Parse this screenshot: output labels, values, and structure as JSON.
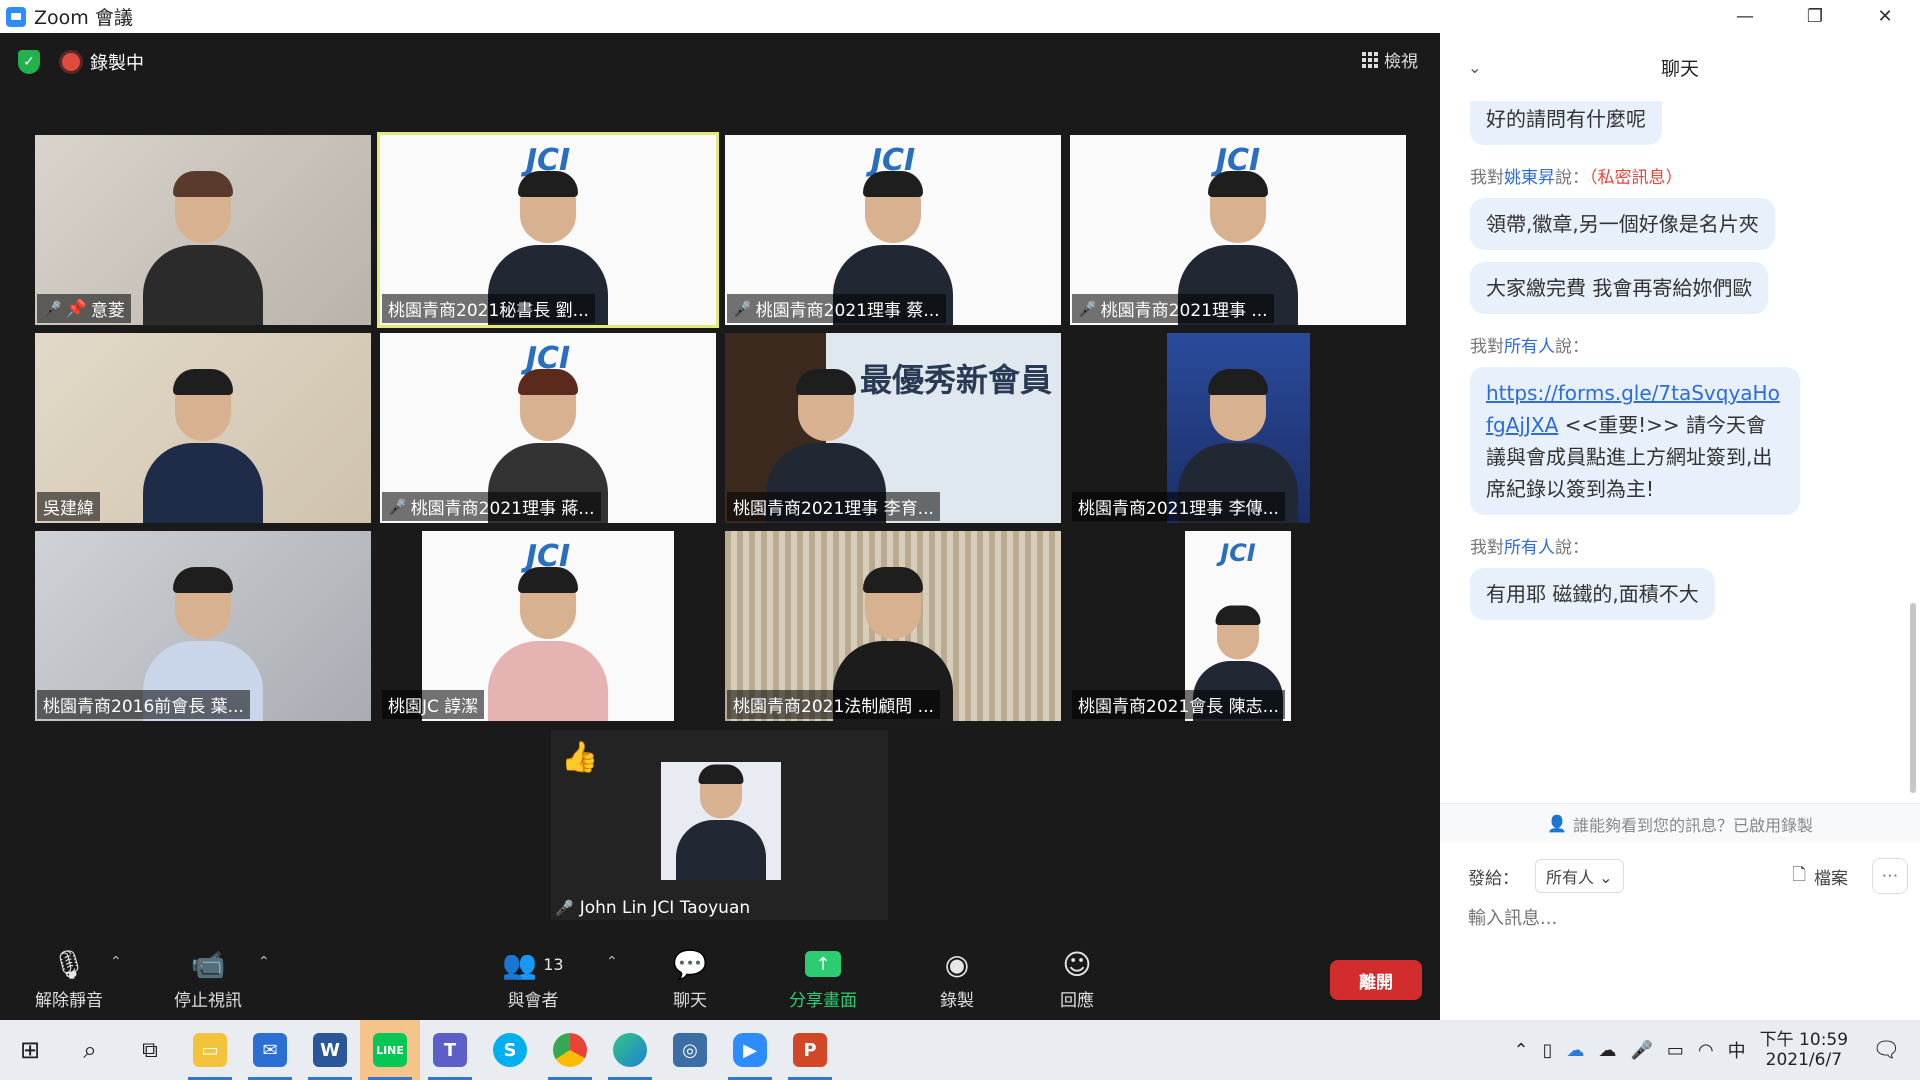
{
  "window": {
    "title": "Zoom 會議"
  },
  "meeting": {
    "recording_label": "錄製中",
    "view_label": "檢視",
    "tiles": [
      {
        "name": "意菱",
        "muted": true,
        "pinned": true
      },
      {
        "name": "桃園青商2021秘書長 劉...",
        "muted": false,
        "active": true
      },
      {
        "name": "桃園青商2021理事 蔡...",
        "muted": true
      },
      {
        "name": "桃園青商2021理事 ...",
        "muted": true
      },
      {
        "name": "吳建緯",
        "muted": false
      },
      {
        "name": "桃園青商2021理事 蔣...",
        "muted": true
      },
      {
        "name": "桃園青商2021理事 李育...",
        "muted": false
      },
      {
        "name": "桃園青商2021理事 李傳...",
        "muted": false
      },
      {
        "name": "桃園青商2016前會長 葉...",
        "muted": false
      },
      {
        "name": "桃園JC 諄潔",
        "muted": false
      },
      {
        "name": "桃園青商2021法制顧問 ...",
        "muted": false
      },
      {
        "name": "桃園青商2021會長 陳志...",
        "muted": false
      }
    ],
    "tile_banner": "JCI",
    "tile_banner_text": "最優秀新會員",
    "solo": {
      "name": "John Lin JCI Taoyuan",
      "muted": true,
      "reaction": "👍"
    }
  },
  "toolbar": {
    "unmute": "解除靜音",
    "stop_video": "停止視訊",
    "participants": "與會者",
    "participants_count": "13",
    "chat": "聊天",
    "share": "分享畫面",
    "record": "錄製",
    "reactions": "回應",
    "leave": "離開"
  },
  "chat": {
    "title": "聊天",
    "messages": [
      {
        "text": "好的請問有什麼呢"
      },
      {
        "meta_prefix": "我對",
        "who": "姚東昇",
        "meta_suffix": "說：",
        "private": "（私密訊息）",
        "text": "領帶,徽章,另一個好像是名片夾"
      },
      {
        "text": "大家繳完費 我會再寄給妳們歐"
      },
      {
        "meta_prefix": "我對",
        "who": "所有人",
        "meta_suffix": "說：",
        "link": "https://forms.gle/7taSvqyaHofgAjJXA",
        "text": "<<重要!>> 請今天會議與會成員點進上方網址簽到,出席紀錄以簽到為主!"
      },
      {
        "meta_prefix": "我對",
        "who": "所有人",
        "meta_suffix": "說：",
        "text": "有用耶 磁鐵的,面積不大"
      }
    ],
    "notice": "誰能夠看到您的訊息？已啟用錄製",
    "send_to_label": "發給：",
    "send_to_value": "所有人",
    "file_label": "檔案",
    "input_placeholder": "輸入訊息..."
  },
  "taskbar": {
    "time": "下午 10:59",
    "date": "2021/6/7",
    "ime": "中"
  }
}
